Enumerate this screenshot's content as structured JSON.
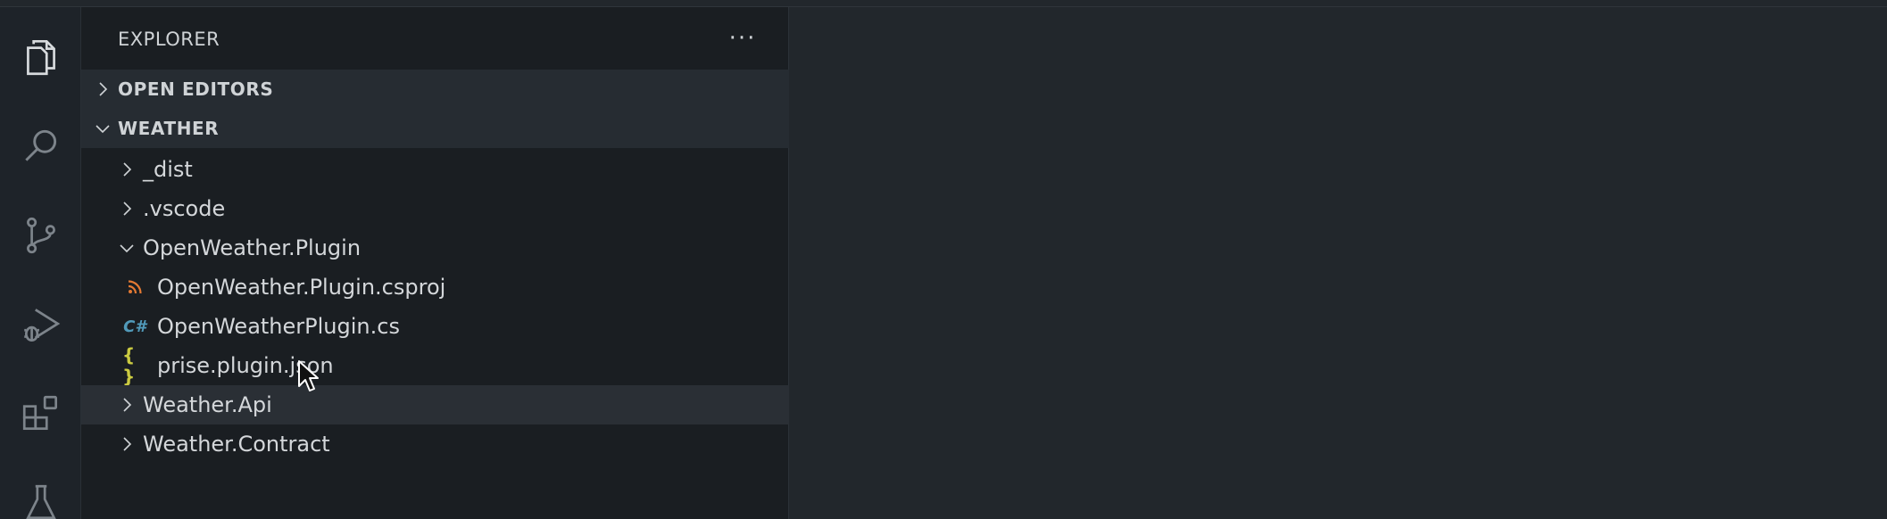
{
  "sidebar": {
    "title": "EXPLORER",
    "more_label": "···",
    "sections": {
      "open_editors": "OPEN EDITORS",
      "workspace": "WEATHER"
    },
    "tree": [
      {
        "label": "_dist",
        "kind": "folder",
        "expanded": false
      },
      {
        "label": ".vscode",
        "kind": "folder",
        "expanded": false
      },
      {
        "label": "OpenWeather.Plugin",
        "kind": "folder",
        "expanded": true
      },
      {
        "label": "OpenWeather.Plugin.csproj",
        "kind": "file",
        "icon": "rss-icon"
      },
      {
        "label": "OpenWeatherPlugin.cs",
        "kind": "file",
        "icon": "csharp-icon"
      },
      {
        "label": "prise.plugin.json",
        "kind": "file",
        "icon": "json-icon"
      },
      {
        "label": "Weather.Api",
        "kind": "folder",
        "expanded": false,
        "hovered": true
      },
      {
        "label": "Weather.Contract",
        "kind": "folder",
        "expanded": false
      }
    ],
    "json_icon_text": "{ }",
    "csharp_icon_text": "C#"
  },
  "activity_bar": [
    "explorer-icon",
    "search-icon",
    "source-control-icon",
    "run-debug-icon",
    "extensions-icon",
    "testing-icon"
  ],
  "colors": {
    "rss": "#e37933",
    "csharp": "#519aba",
    "json": "#cbcb41"
  }
}
